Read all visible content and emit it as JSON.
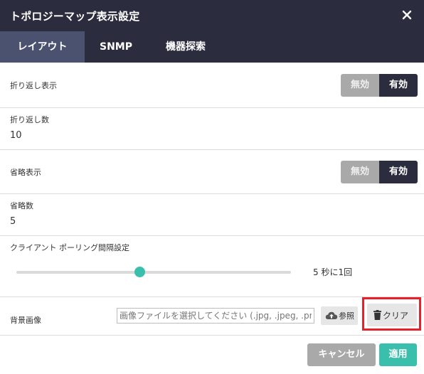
{
  "dialog": {
    "title": "トポロジーマップ表示設定"
  },
  "tabs": [
    {
      "label": "レイアウト",
      "active": true
    },
    {
      "label": "SNMP",
      "active": false
    },
    {
      "label": "機器探索",
      "active": false
    }
  ],
  "settings": {
    "wrap_display": {
      "label": "折り返し表示",
      "off_label": "無効",
      "on_label": "有効",
      "selected": "有効"
    },
    "wrap_count": {
      "label": "折り返し数",
      "value": "10"
    },
    "abbrev_display": {
      "label": "省略表示",
      "off_label": "無効",
      "on_label": "有効",
      "selected": "有効"
    },
    "abbrev_count": {
      "label": "省略数",
      "value": "5"
    },
    "polling": {
      "label": "クライアント ポーリング間隔設定",
      "value_text": "5 秒に1回",
      "slider_fraction": 0.45
    },
    "background_image": {
      "label": "背景画像",
      "placeholder": "画像ファイルを選択してください (.jpg, .jpeg, .png)",
      "browse_label": "参照",
      "clear_label": "クリア"
    }
  },
  "footer": {
    "cancel_label": "キャンセル",
    "apply_label": "適用"
  },
  "colors": {
    "header": "#2b2d3f",
    "active_tab": "#4b5270",
    "accent": "#3bbfad",
    "highlight": "#e8202a"
  },
  "icons": [
    "close-icon",
    "cloud-upload-icon",
    "trash-icon"
  ]
}
